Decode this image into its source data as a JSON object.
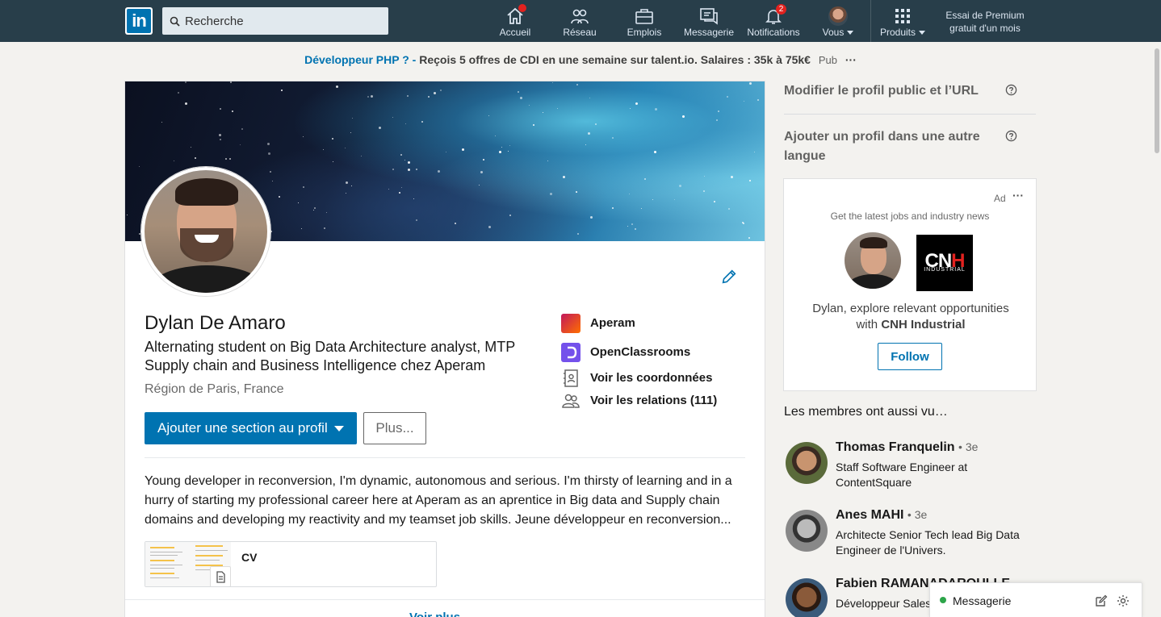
{
  "nav": {
    "search_placeholder": "Recherche",
    "items": [
      {
        "label": "Accueil",
        "icon": "home-icon"
      },
      {
        "label": "Réseau",
        "icon": "network-icon"
      },
      {
        "label": "Emplois",
        "icon": "jobs-icon"
      },
      {
        "label": "Messagerie",
        "icon": "messaging-icon"
      },
      {
        "label": "Notifications",
        "icon": "bell-icon",
        "badge": "2"
      },
      {
        "label": "Vous",
        "icon": "avatar"
      },
      {
        "label": "Produits",
        "icon": "grid-icon"
      }
    ],
    "premium": "Essai de Premium gratuit d'un mois"
  },
  "ad_banner": {
    "lead": "Développeur PHP ? -",
    "text": "Reçois 5 offres de CDI en une semaine sur talent.io. Salaires : 35k à 75k€",
    "pub": "Pub",
    "more": "···"
  },
  "profile": {
    "name": "Dylan De Amaro",
    "headline": "Alternating student on Big Data Architecture analyst, MTP Supply chain and Business Intelligence chez Aperam",
    "location": "Région de Paris, France",
    "add_section_label": "Ajouter une section au profil",
    "more_label": "Plus...",
    "side_links": [
      {
        "label": "Aperam",
        "icon": "aperam-logo"
      },
      {
        "label": "OpenClassrooms",
        "icon": "openclassrooms-logo"
      },
      {
        "label": "Voir les coordonnées",
        "icon": "contact-card-icon"
      },
      {
        "label": "Voir les relations (111)",
        "icon": "people-icon"
      }
    ],
    "summary": "Young developer in reconversion, I'm dynamic, autonomous and serious. I'm thirsty of learning and in a hurry of starting my professional career here at Aperam as an aprentice in Big data and Supply chain domains and developing my reactivity and my teamset job skills. Jeune développeur en reconversion...",
    "media_title": "CV",
    "see_more": "Voir plus"
  },
  "rail": {
    "edit_public_profile": "Modifier le profil public et l’URL",
    "add_language_profile": "Ajouter un profil dans une autre langue",
    "ad": {
      "label": "Ad",
      "dots": "···",
      "subtitle": "Get the latest jobs and industry news",
      "message_prefix": "Dylan, explore relevant opportunities with",
      "company": "CNH Industrial",
      "logo_text": "CNH",
      "logo_sub": "INDUSTRIAL",
      "follow": "Follow"
    },
    "also_viewed_title": "Les membres ont aussi vu…",
    "people": [
      {
        "name": "Thomas Franquelin",
        "degree": "• 3e",
        "title": "Staff Software Engineer at ContentSquare"
      },
      {
        "name": "Anes MAHI",
        "degree": "• 3e",
        "title": "Architecte Senior Tech lead Big Data Engineer de l'Univers."
      },
      {
        "name": "Fabien RAMANADAROULLE",
        "degree": "",
        "title": "Développeur Sales"
      }
    ]
  },
  "messaging": {
    "label": "Messagerie",
    "status_color": "#2da54a"
  },
  "colors": {
    "nav_bg": "#283e4a",
    "brand_blue": "#0073b1",
    "badge_red": "#e2221f"
  }
}
